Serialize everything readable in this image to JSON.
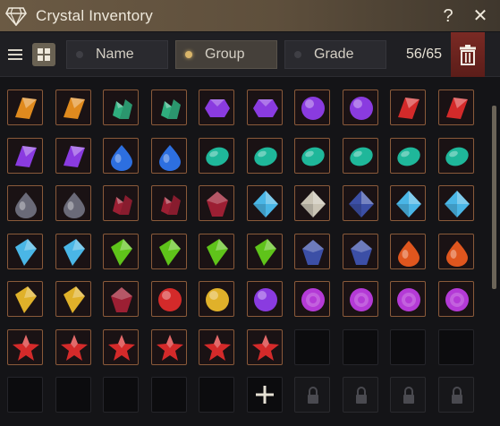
{
  "window": {
    "title": "Crystal Inventory"
  },
  "title_bar": {
    "help": "?",
    "close": "✕"
  },
  "toolbar": {
    "filters": [
      {
        "label": "Name",
        "active": false
      },
      {
        "label": "Group",
        "active": true
      },
      {
        "label": "Grade",
        "active": false
      }
    ],
    "count": "56/65"
  },
  "colors": {
    "amber": "#e08a1e",
    "green": "#2fae7e",
    "violet": "#8a3be0",
    "red": "#d42a2a",
    "blue": "#2d6fe0",
    "teal": "#1fb79a",
    "smoke": "#6a6a78",
    "crimson": "#9c1f33",
    "cyan": "#4ab6e6",
    "silver": "#c9c3b4",
    "navy": "#3c4fa6",
    "lime": "#5fc31a",
    "fire": "#e0561e",
    "gold": "#e0b12a",
    "magenta": "#b43ad6"
  },
  "grid": {
    "columns": 10,
    "rows": [
      [
        "amber-shard",
        "amber-shard",
        "green-cluster",
        "green-cluster",
        "violet-hex",
        "violet-hex",
        "violet-orb",
        "violet-orb",
        "red-shard",
        "red-shard"
      ],
      [
        "violet-shard",
        "violet-shard",
        "blue-drop",
        "blue-drop",
        "teal-oval",
        "teal-oval",
        "teal-oval",
        "teal-oval",
        "teal-oval",
        "teal-oval"
      ],
      [
        "smoke-drop",
        "smoke-drop",
        "crimson-cluster",
        "crimson-cluster",
        "crimson-gem",
        "cyan-diamond",
        "silver-diamond",
        "navy-diamond",
        "cyan-diamond",
        "cyan-diamond"
      ],
      [
        "cyan-kite",
        "cyan-kite",
        "lime-kite",
        "lime-kite",
        "lime-kite",
        "lime-kite",
        "navy-gem",
        "navy-gem",
        "fire-drop",
        "fire-drop"
      ],
      [
        "gold-kite",
        "gold-kite",
        "crimson-gem",
        "red-orb",
        "gold-orb",
        "violet-orb",
        "magenta-rose",
        "magenta-rose",
        "magenta-rose",
        "magenta-rose"
      ],
      [
        "red-star",
        "red-star",
        "red-star",
        "red-star",
        "red-star",
        "red-star",
        "empty",
        "empty",
        "empty",
        "empty"
      ],
      [
        "empty",
        "empty",
        "empty",
        "empty",
        "empty",
        "add",
        "locked",
        "locked",
        "locked",
        "locked"
      ]
    ]
  }
}
